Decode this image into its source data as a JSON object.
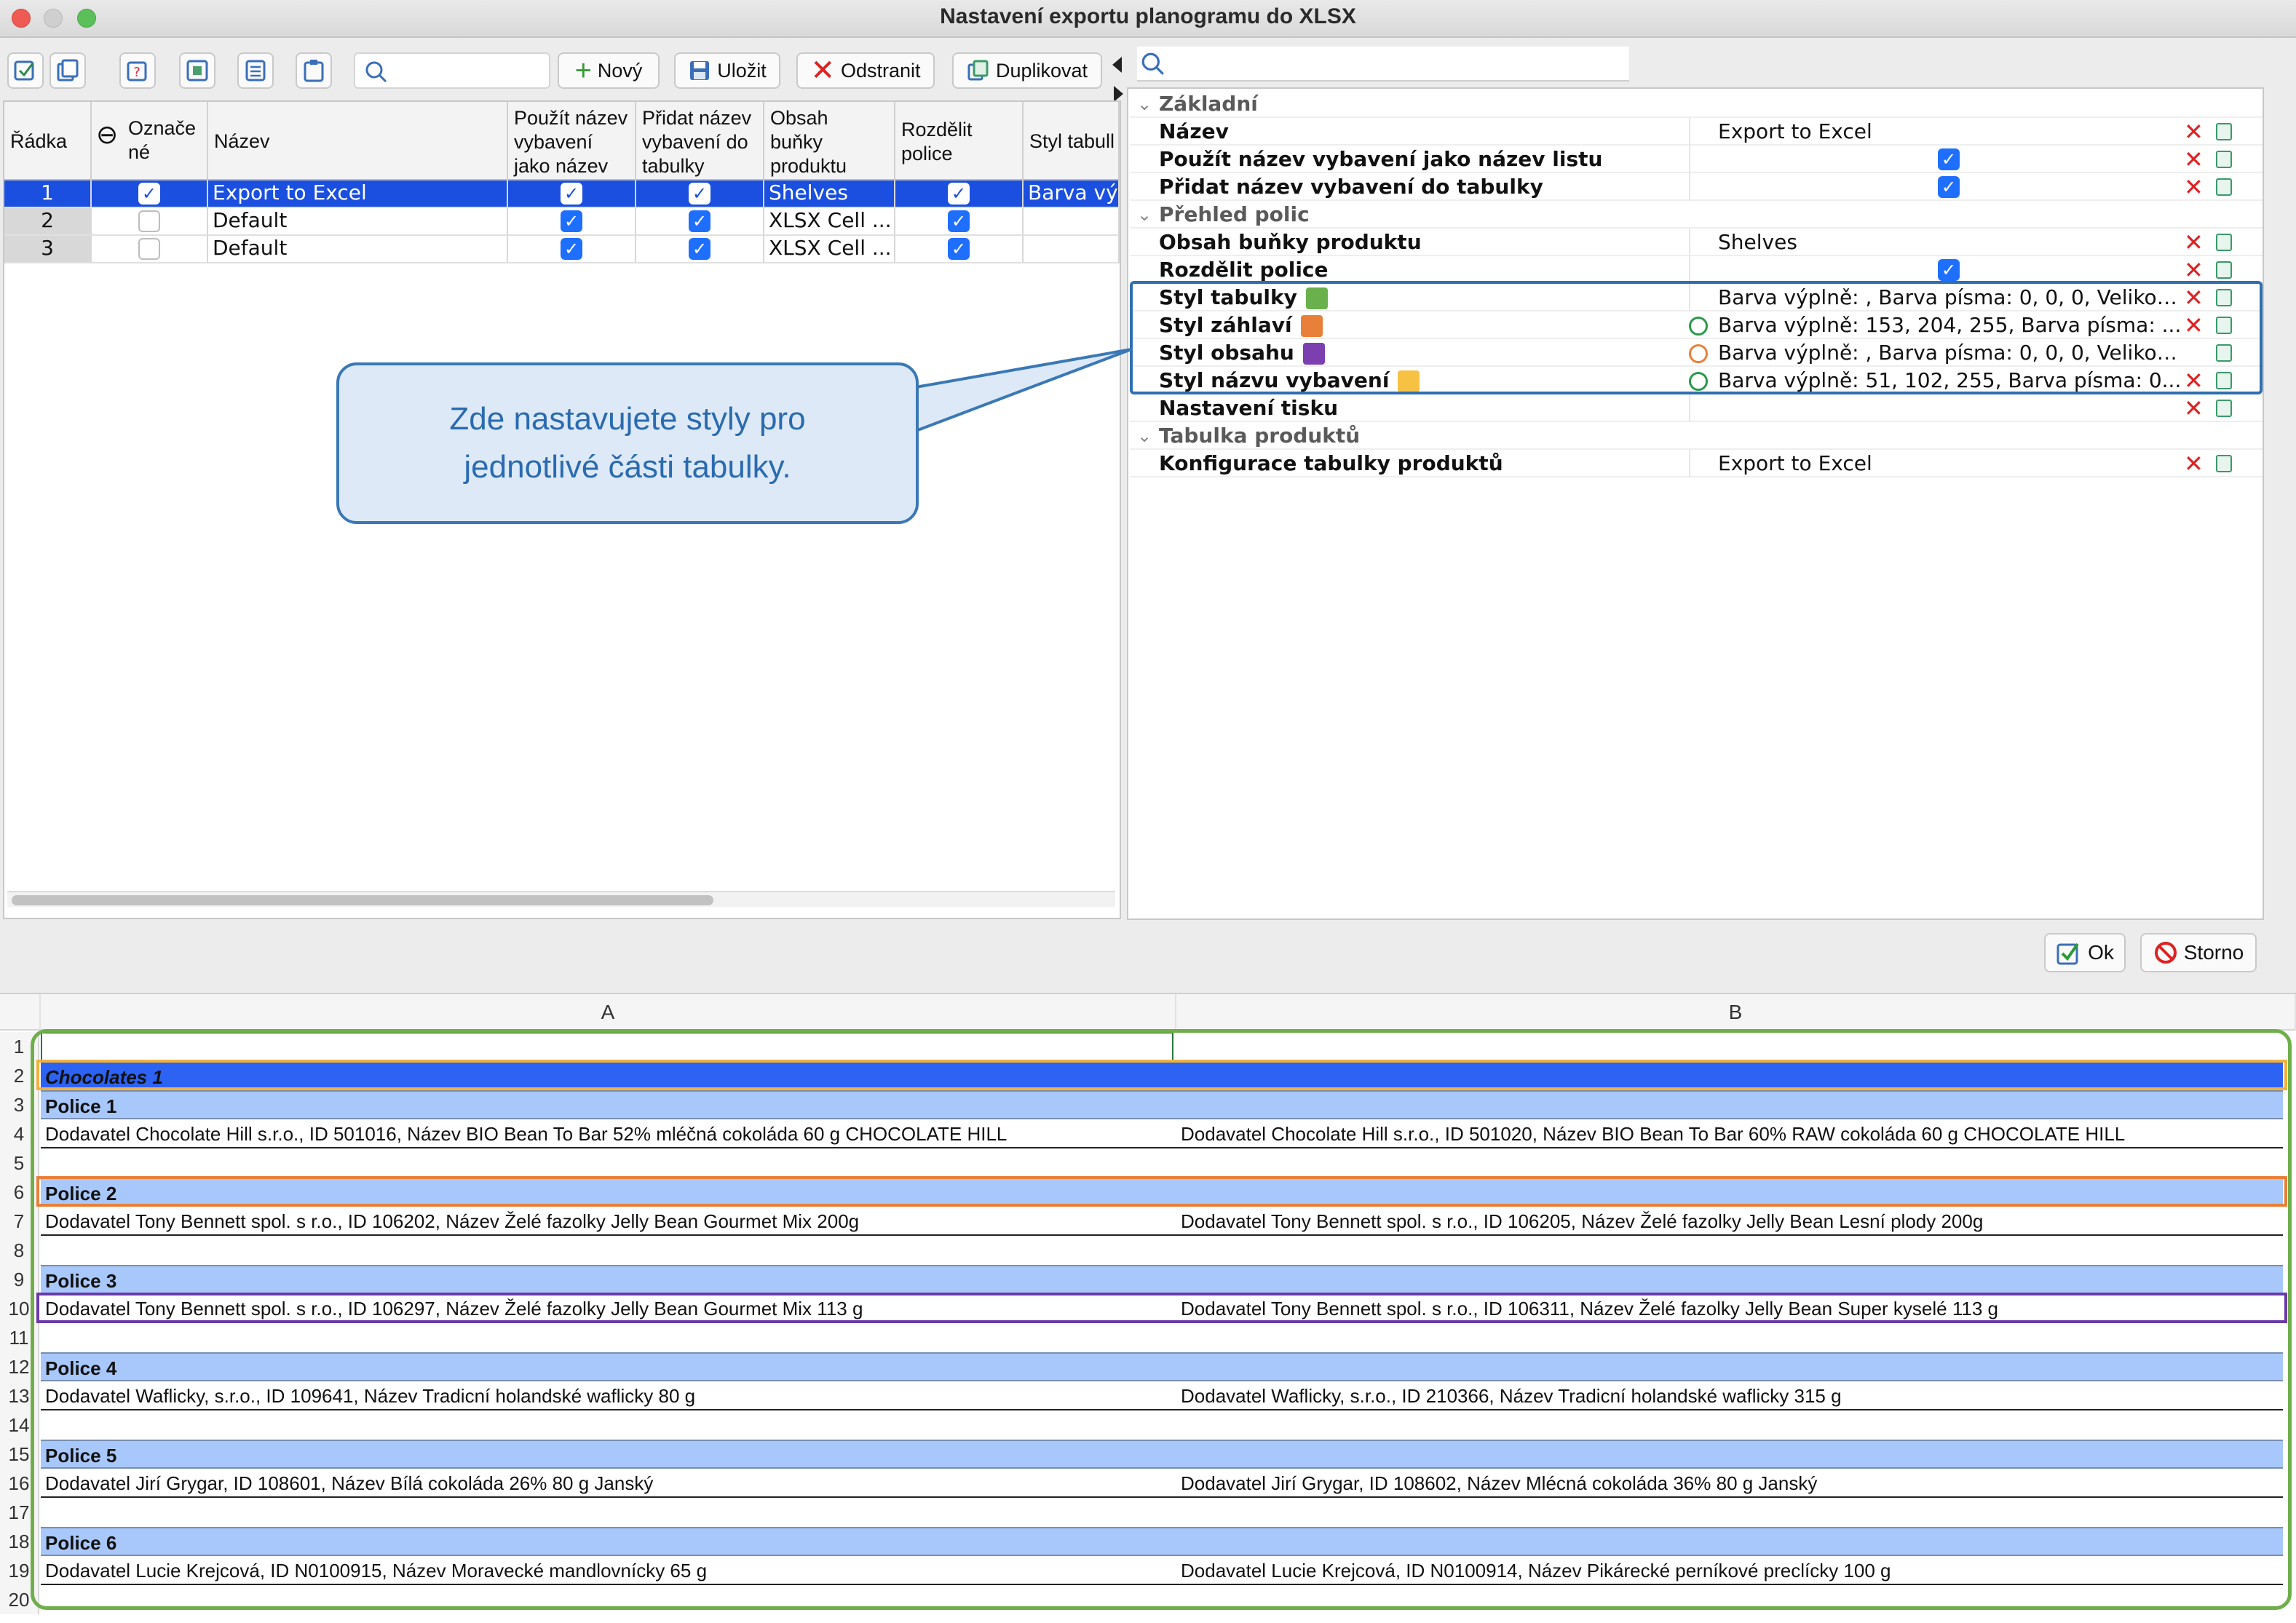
{
  "window": {
    "title": "Nastavení exportu planogramu do XLSX"
  },
  "toolbar": {
    "new_label": "Nový",
    "save_label": "Uložit",
    "delete_label": "Odstranit",
    "duplicate_label": "Duplikovat",
    "search_placeholder": ""
  },
  "left_table": {
    "headers": {
      "row": "Řádka",
      "marked_line1": "Označe",
      "marked_line2": "né",
      "name": "Název",
      "use_name_1": "Použít název",
      "use_name_2": "vybavení",
      "use_name_3": "jako název ...",
      "add_name_1": "Přidat název",
      "add_name_2": "vybavení do",
      "add_name_3": "tabulky",
      "content_1": "Obsah",
      "content_2": "buňky",
      "content_3": "produktu",
      "split_1": "Rozdělit",
      "split_2": "police",
      "style": "Styl tabull"
    },
    "rows": [
      {
        "num": "1",
        "marked": true,
        "name": "Export to Excel",
        "use_name": true,
        "add_name": true,
        "content": "Shelves",
        "split": true,
        "style": "Barva výp"
      },
      {
        "num": "2",
        "marked": false,
        "name": "Default",
        "use_name": true,
        "add_name": true,
        "content": "XLSX Cell ...",
        "split": true,
        "style": ""
      },
      {
        "num": "3",
        "marked": false,
        "name": "Default",
        "use_name": true,
        "add_name": true,
        "content": "XLSX Cell ...",
        "split": true,
        "style": ""
      }
    ]
  },
  "properties": {
    "group_basic": "Základní",
    "name_label": "Název",
    "name_value": "Export to Excel",
    "use_name_label": "Použít název vybavení jako název listu",
    "add_name_label": "Přidat název vybavení do tabulky",
    "group_shelves": "Přehled polic",
    "content_label": "Obsah buňky produktu",
    "content_value": "Shelves",
    "split_label": "Rozdělit police",
    "table_style_label": "Styl tabulky",
    "table_style_value": "Barva výplně: , Barva písma: 0, 0, 0, Velikos...",
    "header_style_label": "Styl záhlaví",
    "header_style_value": "Barva výplně: 153, 204, 255, Barva písma: ...",
    "content_style_label": "Styl obsahu",
    "content_style_value": "Barva výplně: , Barva písma: 0, 0, 0, Velikos...",
    "equip_style_label": "Styl názvu vybavení",
    "equip_style_value": "Barva výplně: 51, 102, 255, Barva písma: 0...",
    "print_label": "Nastavení tisku",
    "group_products": "Tabulka produktů",
    "product_config_label": "Konfigurace tabulky produktů",
    "product_config_value": "Export to Excel"
  },
  "callout": {
    "line1": "Zde nastavujete styly pro",
    "line2": "jednotlivé části tabulky."
  },
  "footer": {
    "ok_label": "Ok",
    "cancel_label": "Storno"
  },
  "sheet": {
    "col_a": "A",
    "col_b": "B",
    "rows": [
      {
        "n": "1",
        "a": "",
        "b": "",
        "kind": "plain"
      },
      {
        "n": "2",
        "a": "Chocolates 1",
        "b": "",
        "kind": "equip"
      },
      {
        "n": "3",
        "a": "Police 1",
        "b": "",
        "kind": "header"
      },
      {
        "n": "4",
        "a": "Dodavatel Chocolate Hill s.r.o., ID 501016, Název BIO Bean To Bar 52% mléčná cokoláda 60 g CHOCOLATE HILL",
        "b": "Dodavatel Chocolate Hill s.r.o., ID 501020, Název BIO Bean To Bar 60% RAW cokoláda 60 g CHOCOLATE HILL",
        "kind": "body"
      },
      {
        "n": "5",
        "a": "",
        "b": "",
        "kind": "plain"
      },
      {
        "n": "6",
        "a": "Police 2",
        "b": "",
        "kind": "header"
      },
      {
        "n": "7",
        "a": "Dodavatel Tony Bennett spol. s r.o., ID 106202, Název Želé fazolky Jelly Bean Gourmet Mix 200g",
        "b": "Dodavatel Tony Bennett spol. s r.o., ID 106205, Název Želé fazolky Jelly Bean Lesní plody 200g",
        "kind": "body"
      },
      {
        "n": "8",
        "a": "",
        "b": "",
        "kind": "plain"
      },
      {
        "n": "9",
        "a": "Police 3",
        "b": "",
        "kind": "header"
      },
      {
        "n": "10",
        "a": "Dodavatel Tony Bennett spol. s r.o., ID 106297, Název Želé fazolky Jelly Bean Gourmet Mix 113 g",
        "b": "Dodavatel Tony Bennett spol. s r.o., ID 106311, Název Želé fazolky Jelly Bean Super kyselé 113 g",
        "kind": "body"
      },
      {
        "n": "11",
        "a": "",
        "b": "",
        "kind": "plain"
      },
      {
        "n": "12",
        "a": "Police 4",
        "b": "",
        "kind": "header"
      },
      {
        "n": "13",
        "a": "Dodavatel Waflicky, s.r.o., ID 109641, Název Tradicní holandské waflicky 80 g",
        "b": "Dodavatel Waflicky, s.r.o., ID 210366, Název Tradicní holandské waflicky 315 g",
        "kind": "body"
      },
      {
        "n": "14",
        "a": "",
        "b": "",
        "kind": "plain"
      },
      {
        "n": "15",
        "a": "Police 5",
        "b": "",
        "kind": "header"
      },
      {
        "n": "16",
        "a": "Dodavatel Jirí Grygar, ID 108601, Název Bílá cokoláda 26% 80 g Janský",
        "b": "Dodavatel Jirí Grygar, ID 108602, Název Mlécná cokoláda 36% 80 g Janský",
        "kind": "body"
      },
      {
        "n": "17",
        "a": "",
        "b": "",
        "kind": "plain"
      },
      {
        "n": "18",
        "a": "Police 6",
        "b": "",
        "kind": "header"
      },
      {
        "n": "19",
        "a": "Dodavatel Lucie Krejcová, ID N0100915, Název Moravecké mandlovnícky 65 g",
        "b": "Dodavatel Lucie Krejcová, ID N0100914, Název Pikárecké perníkové preclícky 100 g",
        "kind": "body"
      },
      {
        "n": "20",
        "a": "",
        "b": "",
        "kind": "plain"
      }
    ]
  },
  "colors": {
    "equip_fill": "#2d63f2",
    "header_fill": "#a8c7fa",
    "swatch_table": "#6ab04c",
    "swatch_header": "#e8803a",
    "swatch_content": "#7b3fb0",
    "swatch_equip": "#f7c144",
    "outline_table": "#6fae4b",
    "outline_equip": "#f2b13c",
    "outline_header": "#e8803a",
    "outline_content": "#6a3aa8",
    "callout_border": "#3a78b6"
  }
}
